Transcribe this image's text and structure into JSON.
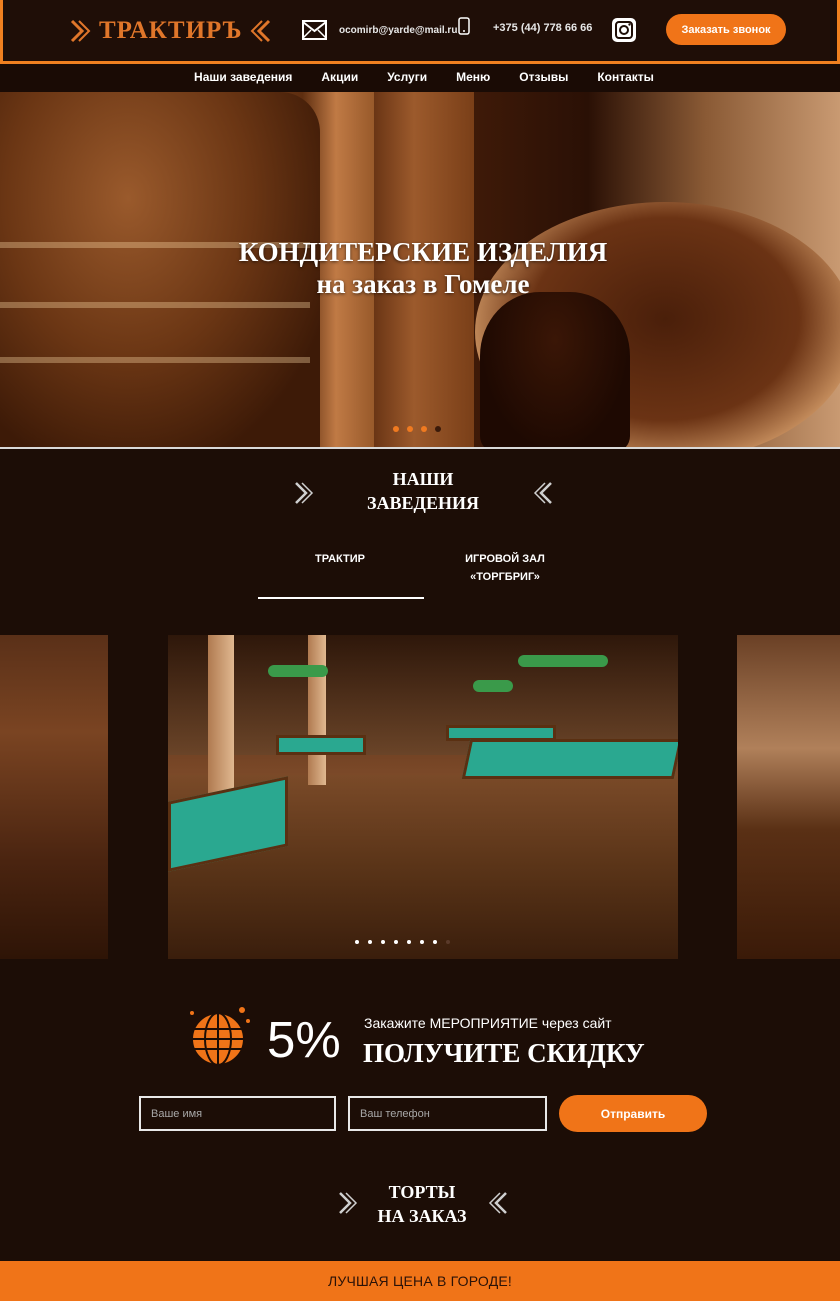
{
  "header": {
    "logo_text": "ТРАКТИРЪ",
    "email": "ocomirb@yarde@mail.ru",
    "phone": "+375 (44) 778 66 66",
    "callback_label": "Заказать звонок"
  },
  "nav": {
    "items": [
      {
        "label": "Наши заведения"
      },
      {
        "label": "Акции"
      },
      {
        "label": "Услуги"
      },
      {
        "label": "Меню"
      },
      {
        "label": "Отзывы"
      },
      {
        "label": "Контакты"
      }
    ]
  },
  "hero": {
    "title_line1": "КОНДИТЕРСКИЕ ИЗДЕЛИЯ",
    "title_line2": "на заказ в Гомеле",
    "slides_total": 4,
    "active_slide": 3
  },
  "venues": {
    "title_line1": "НАШИ",
    "title_line2": "ЗАВЕДЕНИЯ",
    "tabs": [
      {
        "label_line1": "ТРАКТИР",
        "label_line2": "",
        "active": true
      },
      {
        "label_line1": "ИГРОВОЙ ЗАЛ",
        "label_line2": "«ТОРГБРИГ»",
        "active": false
      }
    ],
    "gallery_slides_total": 8,
    "gallery_active_slide": 8
  },
  "promo": {
    "percent": "5%",
    "subtitle": "Закажите МЕРОПРИЯТИЕ через сайт",
    "headline": "ПОЛУЧИТЕ СКИДКУ",
    "name_placeholder": "Ваше имя",
    "phone_placeholder": "Ваш телефон",
    "submit_label": "Отправить"
  },
  "cakes": {
    "title_line1": "ТОРТЫ",
    "title_line2": "НА ЗАКАЗ"
  },
  "footer_band": {
    "text": "ЛУЧШАЯ ЦЕНА В ГОРОДЕ!"
  },
  "colors": {
    "accent": "#f07418",
    "background": "#1c0d06",
    "logo": "#e0762a"
  }
}
